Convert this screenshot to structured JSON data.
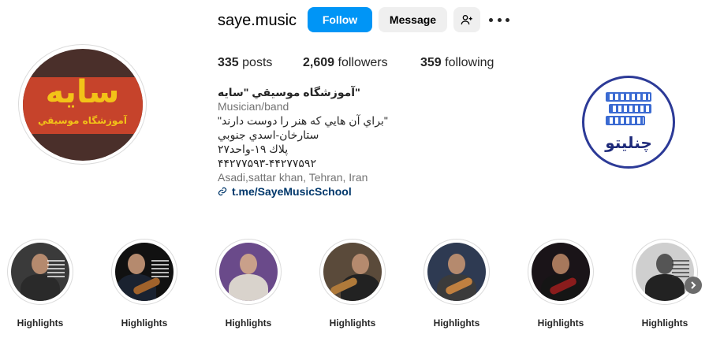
{
  "profile": {
    "username": "saye.music",
    "avatar": {
      "logo_text": "سایه",
      "logo_subtext": "آموزشگاه موسيقي"
    }
  },
  "actions": {
    "follow_label": "Follow",
    "message_label": "Message",
    "suggest_icon": "add-person-icon",
    "more_icon": "more-dots-icon"
  },
  "stats": {
    "posts_count": "335",
    "posts_label": "posts",
    "followers_count": "2,609",
    "followers_label": "followers",
    "following_count": "359",
    "following_label": "following"
  },
  "bio": {
    "name": "آموزشگاه موسيقي \"سايه\"",
    "category": "Musician/band",
    "lines": [
      "\"براي آن هايي که هنر را دوست دارند\"",
      "ستارخان-اسدي جنوبي",
      "پلاك ۱۹-واحد۲۷",
      "۴۴۲۷۷۵۹۳-۴۴۲۷۷۵۹۲"
    ],
    "address": "Asadi,sattar khan, Tehran, Iran",
    "link_icon": "link-icon",
    "link_text": "t.me/SayeMusicSchool"
  },
  "badge": {
    "text": "چنلیتو"
  },
  "highlights": [
    {
      "label": "Highlights"
    },
    {
      "label": "Highlights"
    },
    {
      "label": "Highlights"
    },
    {
      "label": "Highlights"
    },
    {
      "label": "Highlights"
    },
    {
      "label": "Highlights"
    },
    {
      "label": "Highlights"
    }
  ],
  "colors": {
    "follow_button": "#0095f6",
    "secondary_button": "#efefef",
    "link": "#00376b",
    "muted_text": "#737373"
  }
}
